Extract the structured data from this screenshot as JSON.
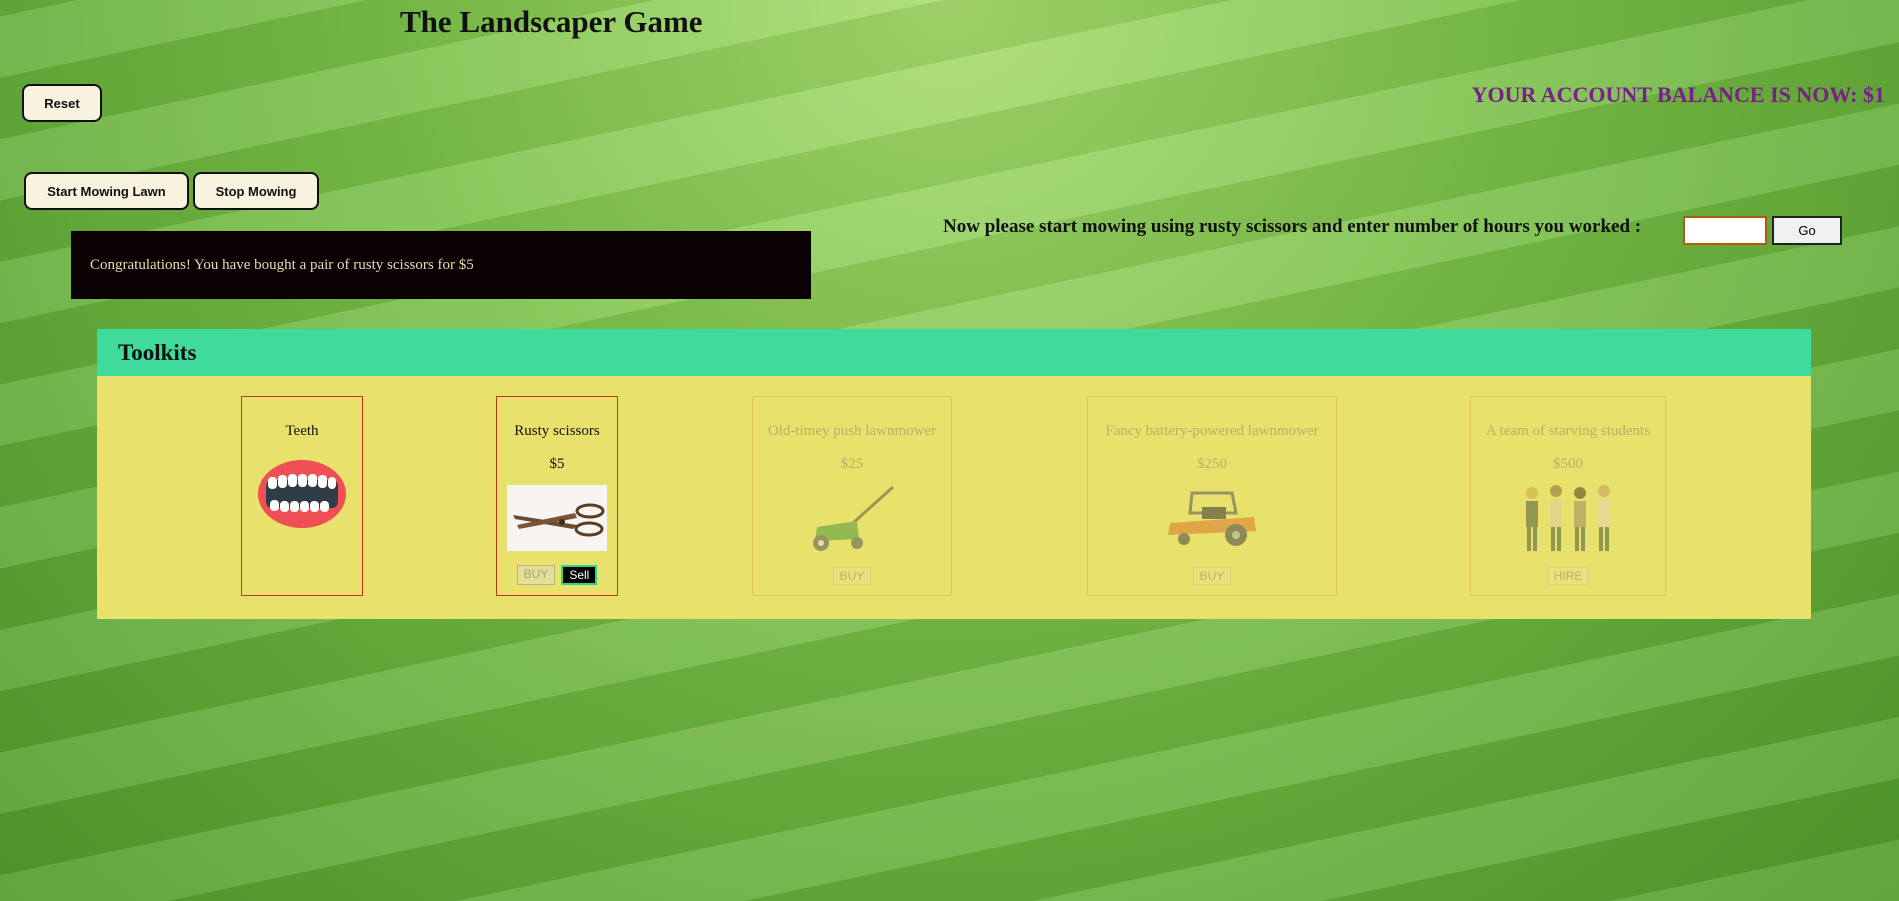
{
  "title": "The Landscaper Game",
  "reset_label": "Reset",
  "start_label": "Start Mowing Lawn",
  "stop_label": "Stop Mowing",
  "balance_text": "YOUR ACCOUNT BALANCE IS NOW: $1",
  "message": "Congratulations! You have bought a pair of rusty scissors for $5",
  "prompt": "Now please start mowing using rusty scissors and enter number of hours you worked :",
  "hours_value": "",
  "go_label": "Go",
  "toolkits": {
    "heading": "Toolkits",
    "items": [
      {
        "name": "Teeth",
        "price": "",
        "icon": "teeth-icon",
        "buttons": []
      },
      {
        "name": "Rusty scissors",
        "price": "$5",
        "icon": "scissors-icon",
        "buttons": [
          "BUY",
          "Sell"
        ]
      },
      {
        "name": "Old-timey push lawnmower",
        "price": "$25",
        "icon": "push-lawnmower-icon",
        "buttons": [
          "BUY"
        ]
      },
      {
        "name": "Fancy battery-powered lawnmower",
        "price": "$250",
        "icon": "riding-lawnmower-icon",
        "buttons": [
          "BUY"
        ]
      },
      {
        "name": "A team of starving students",
        "price": "$500",
        "icon": "students-icon",
        "buttons": [
          "HIRE"
        ]
      }
    ]
  },
  "colors": {
    "balance": "#7a1e8c",
    "panel_header": "#3fdb9c",
    "panel_body": "#e8e26c",
    "message_bg": "#0a0202"
  }
}
